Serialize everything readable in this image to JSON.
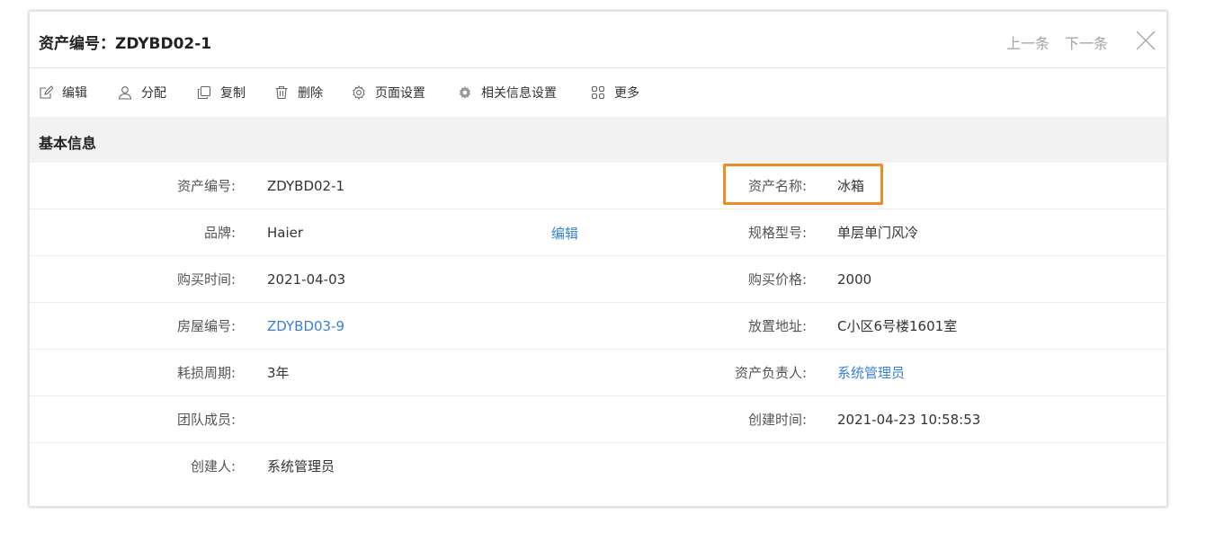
{
  "header": {
    "title": "资产编号：ZDYBD02-1",
    "prev_label": "上一条",
    "next_label": "下一条"
  },
  "toolbar": {
    "items": [
      {
        "label": "编辑",
        "icon": "edit-icon"
      },
      {
        "label": "分配",
        "icon": "user-icon"
      },
      {
        "label": "复制",
        "icon": "copy-icon"
      },
      {
        "label": "删除",
        "icon": "trash-icon"
      },
      {
        "label": "页面设置",
        "icon": "gear-icon"
      },
      {
        "label": "相关信息设置",
        "icon": "gear-filled-icon"
      },
      {
        "label": "更多",
        "icon": "grid-icon"
      }
    ]
  },
  "section": {
    "title": "基本信息",
    "edit_label": "编辑"
  },
  "fields": {
    "left": [
      {
        "label": "资产编号:",
        "value": "ZDYBD02-1"
      },
      {
        "label": "品牌:",
        "value": "Haier"
      },
      {
        "label": "购买时间:",
        "value": "2021-04-03"
      },
      {
        "label": "房屋编号:",
        "value": "ZDYBD03-9"
      },
      {
        "label": "耗损周期:",
        "value": "3年"
      },
      {
        "label": "团队成员:",
        "value": ""
      },
      {
        "label": "创建人:",
        "value": "系统管理员"
      }
    ],
    "right": [
      {
        "label": "资产名称:",
        "value": "冰箱"
      },
      {
        "label": "规格型号:",
        "value": "单层单门风冷"
      },
      {
        "label": "购买价格:",
        "value": "2000"
      },
      {
        "label": "放置地址:",
        "value": "C小区6号楼1601室"
      },
      {
        "label": "资产负责人:",
        "value": "系统管理员"
      },
      {
        "label": "创建时间:",
        "value": "2021-04-23 10:58:53"
      }
    ]
  },
  "colors": {
    "link": "#3a7fd5",
    "highlight": "#f08a24",
    "section_bg": "#f2f2f2"
  }
}
